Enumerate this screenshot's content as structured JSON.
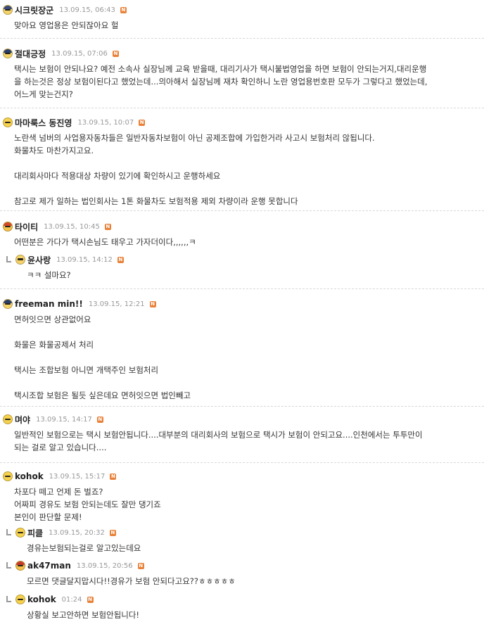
{
  "comments": [
    {
      "nick": "시크릿장군",
      "date": "13.09.15, 06:43",
      "badge": "N",
      "avatar": "avatar-icon",
      "body": "맞아요 영업용은 안되잖아요 헐"
    },
    {
      "nick": "절대긍정",
      "date": "13.09.15, 07:06",
      "badge": "N",
      "avatar": "avatar-icon",
      "body": "택시는 보험이 안되나요? 예전 소속사 실장님께 교육 받을때, 대리기사가 택시불법영업을 하면 보험이 안되는거지,대리운행\n을 하는것은 정상 보험이된다고 했었는데...의아해서 실장님께 재차 확인하니 노란 영업용번호판 모두가 그렇다고 했었는데,\n어느게 맞는건지?"
    },
    {
      "nick": "마마룩스 동진영",
      "date": "13.09.15, 10:07",
      "badge": "N",
      "avatar": "avatar-icon",
      "body": "노란색 넘버의 사업용자동차들은 일반자동차보험이 아닌 공제조합에 가입한거라 사고시 보험처리 않됩니다.\n화물차도 마찬가지고요.\n\n대리회사마다 적용대상 차량이 있기에 확인하시고 운행하세요\n\n참고로 제가 일하는 법인회사는 1톤 화물차도 보험적용 제외 차량이라 운행 못합니다"
    },
    {
      "nick": "타이티",
      "date": "13.09.15, 10:45",
      "badge": "N",
      "avatar": "avatar-icon",
      "body": "어떤분은 가다가 택시손님도 태우고 가자더이다,,,,,,ㅋ"
    },
    {
      "nick": "윤사랑",
      "date": "13.09.15, 14:12",
      "badge": "N",
      "avatar": "avatar-icon",
      "body": "ㅋㅋ 설마요?"
    },
    {
      "nick": "freeman min!!",
      "date": "13.09.15, 12:21",
      "badge": "N",
      "avatar": "avatar-icon",
      "body": "면허잇으면 상관없어요\n\n화물은 화물공제서 처리\n\n택시는 조합보험 아니면 개택주인 보험처리\n\n택시조합 보험은 될듯 싶은데요 면허잇으면 법인빼고"
    },
    {
      "nick": "며야",
      "date": "13.09.15, 14:17",
      "badge": "N",
      "avatar": "avatar-icon",
      "body": "일반적인 보험으로는 택시 보험안됩니다....대부분의 대리회사의 보험으로 택시가 보험이 안되고요....인천에서는 투투만이\n되는 걸로 알고 있습니다...."
    },
    {
      "nick": "kohok",
      "date": "13.09.15, 15:17",
      "badge": "N",
      "avatar": "avatar-icon",
      "body": "차포다 떼고 언제 돈 벌죠?\n어짜피 경유도 보험 안되는데도 잘만 댕기죠\n본인이 판단할 문제!"
    },
    {
      "nick": "피클",
      "date": "13.09.15, 20:32",
      "badge": "N",
      "avatar": "avatar-icon",
      "body": "경유는보험되는걸로 알고있는데요"
    },
    {
      "nick": "ak47man",
      "date": "13.09.15, 20:56",
      "badge": "N",
      "avatar": "avatar-icon",
      "body": "모르면 댓글달지맙시다!!경유가 보험 안되다고요??ㅎㅎㅎㅎㅎ"
    },
    {
      "nick": "kohok",
      "date": "01:24",
      "badge": "N",
      "avatar": "avatar-icon",
      "body": "상황실 보고안하면 보험안됩니다!"
    }
  ],
  "colors": {
    "badge": "#e8823a",
    "divider": "#d8d8d8",
    "date": "#999999"
  }
}
